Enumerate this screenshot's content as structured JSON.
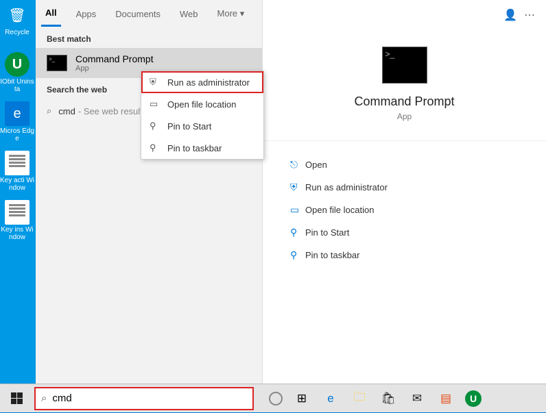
{
  "desktop_icons": [
    {
      "id": "recycle-bin",
      "label": "Recycle"
    },
    {
      "id": "iobit-uninstaller",
      "label": "IObit Uninsta"
    },
    {
      "id": "microsoft-edge",
      "label": "Micros Edge"
    },
    {
      "id": "key-activate",
      "label": "Key acti Window"
    },
    {
      "id": "key-install",
      "label": "Key ins Window"
    }
  ],
  "tabs": {
    "items": [
      "All",
      "Apps",
      "Documents",
      "Web",
      "More"
    ],
    "active": 0,
    "more_glyph": "▾"
  },
  "best_match_header": "Best match",
  "best_match": {
    "title": "Command Prompt",
    "subtitle": "App"
  },
  "search_web_header": "Search the web",
  "web_result": {
    "query": "cmd",
    "hint": "- See web result"
  },
  "context_menu": [
    {
      "icon": "admin",
      "label": "Run as administrator",
      "highlight": true
    },
    {
      "icon": "folder",
      "label": "Open file location"
    },
    {
      "icon": "pin",
      "label": "Pin to Start"
    },
    {
      "icon": "pin",
      "label": "Pin to taskbar"
    }
  ],
  "details": {
    "title": "Command Prompt",
    "subtitle": "App",
    "actions": [
      {
        "icon": "open",
        "label": "Open"
      },
      {
        "icon": "admin",
        "label": "Run as administrator"
      },
      {
        "icon": "folder",
        "label": "Open file location"
      },
      {
        "icon": "pin",
        "label": "Pin to Start"
      },
      {
        "icon": "pin",
        "label": "Pin to taskbar"
      }
    ]
  },
  "search_box": {
    "value": "cmd"
  },
  "icon_glyphs": {
    "admin": "⛨",
    "folder": "▭",
    "pin": "⚲",
    "open": "⎋",
    "search": "⌕",
    "user": "👤",
    "more": "⋯",
    "taskview": "⊞",
    "store": "🛍",
    "mail": "✉",
    "office": "▤",
    "chevron": "▾"
  }
}
